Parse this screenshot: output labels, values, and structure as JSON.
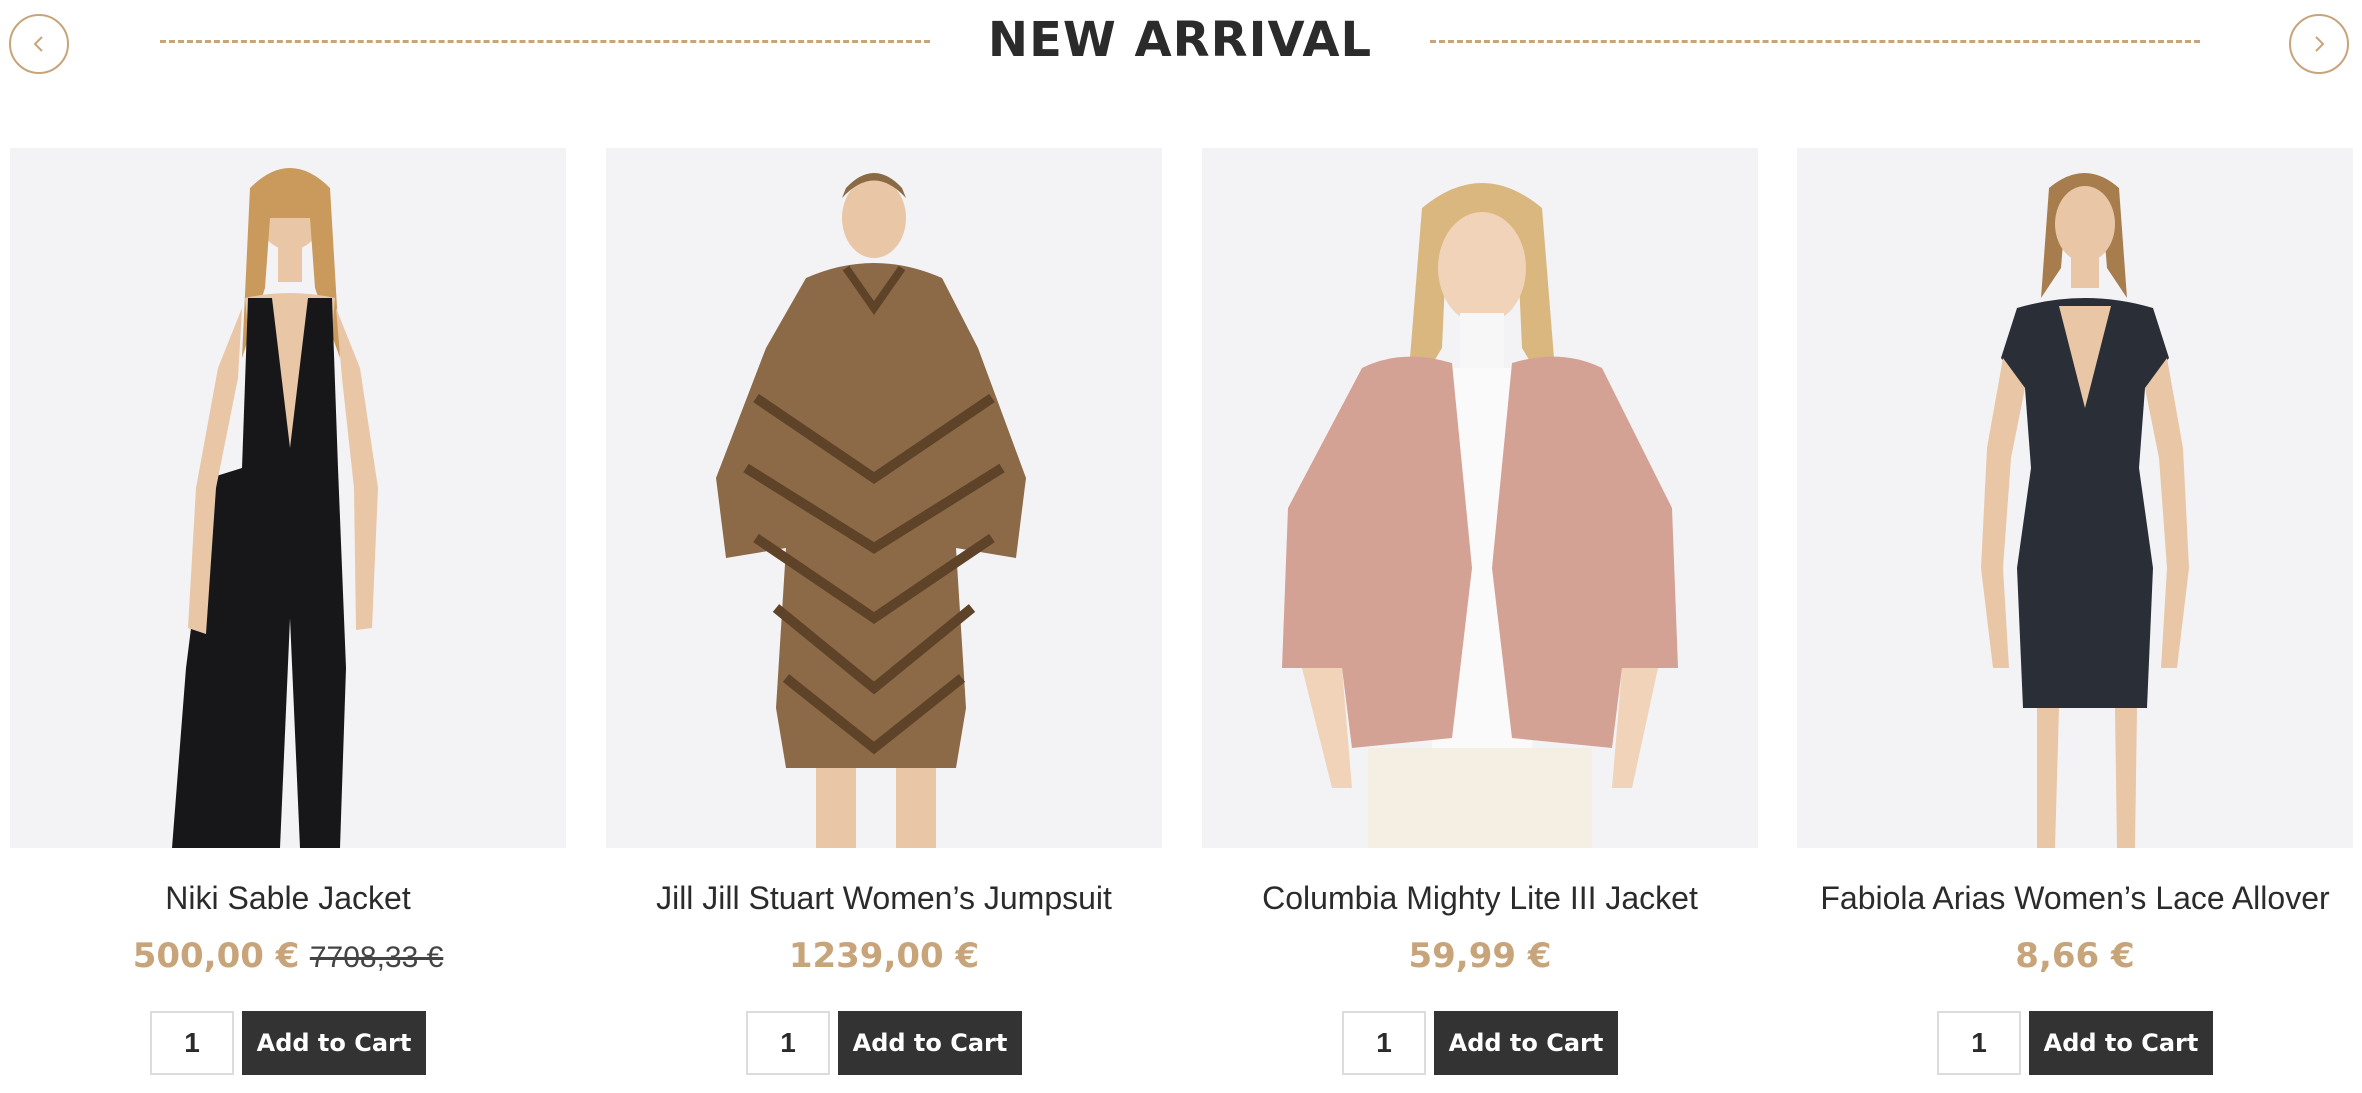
{
  "section": {
    "title": "NEW ARRIVAL",
    "prev_icon": "chevron-left-icon",
    "next_icon": "chevron-right-icon"
  },
  "colors": {
    "accent": "#c7a47a",
    "button_bg": "#333333",
    "image_bg": "#f3f3f5"
  },
  "products": [
    {
      "name": "Niki Sable Jacket",
      "price": "500,00 €",
      "old_price": "7708,33 €",
      "quantity": "1",
      "cart_label": "Add to Cart",
      "image": "black-halter-jumpsuit"
    },
    {
      "name": "Jill Jill Stuart Women’s Jumpsuit",
      "price": "1239,00 €",
      "old_price": "",
      "quantity": "1",
      "cart_label": "Add to Cart",
      "image": "brown-fur-coat"
    },
    {
      "name": "Columbia Mighty Lite III Jacket",
      "price": "59,99 €",
      "old_price": "",
      "quantity": "1",
      "cart_label": "Add to Cart",
      "image": "pink-faux-fur-jacket"
    },
    {
      "name": "Fabiola Arias Women’s Lace Allover",
      "price": "8,66 €",
      "old_price": "",
      "quantity": "1",
      "cart_label": "Add to Cart",
      "image": "sequin-mini-dress"
    }
  ]
}
